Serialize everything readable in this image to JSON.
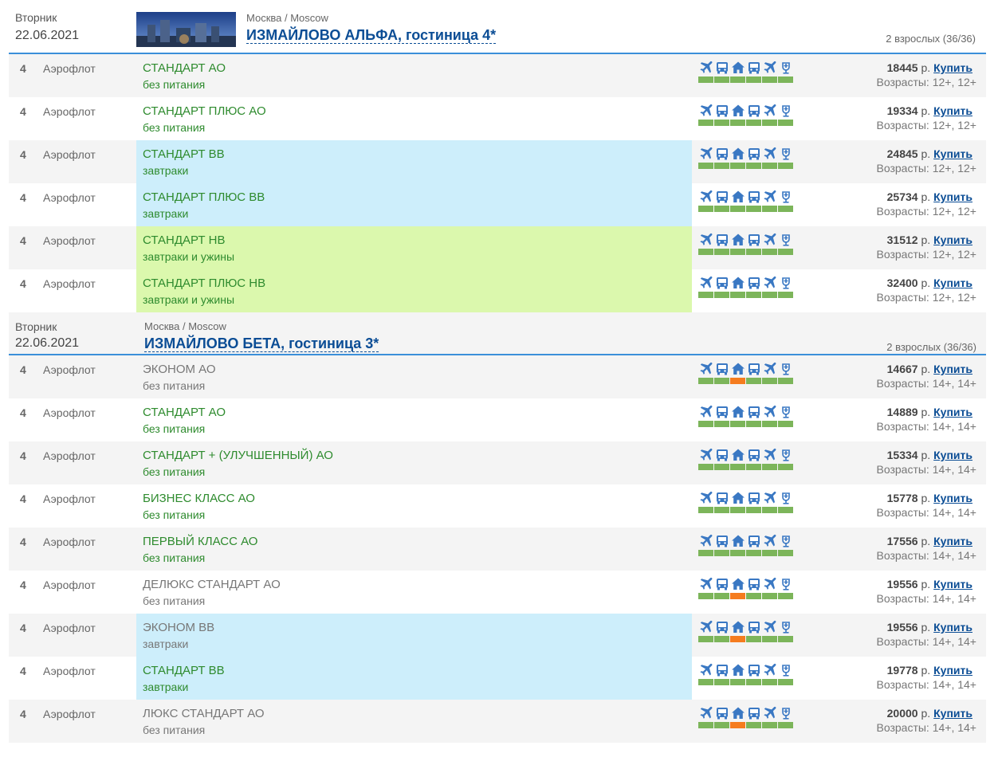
{
  "hotels": [
    {
      "day": "Вторник",
      "date": "22.06.2021",
      "city": "Москва / Moscow",
      "title": "ИЗМАЙЛОВО АЛЬФА, гостиница 4*",
      "adults": "2 взрослых (36/36)",
      "rows": [
        {
          "nights": "4",
          "airline": "Аэрофлот",
          "room": "СТАНДАРТ АО",
          "meal": "без питания",
          "price": "18445",
          "ages": "Возрасты: 12+, 12+",
          "room_color": "green",
          "meal_class": "none"
        },
        {
          "nights": "4",
          "airline": "Аэрофлот",
          "room": "СТАНДАРТ ПЛЮС АО",
          "meal": "без питания",
          "price": "19334",
          "ages": "Возрасты: 12+, 12+",
          "room_color": "green",
          "meal_class": "none"
        },
        {
          "nights": "4",
          "airline": "Аэрофлот",
          "room": "СТАНДАРТ ВВ",
          "meal": "завтраки",
          "price": "24845",
          "ages": "Возрасты: 12+, 12+",
          "room_color": "green",
          "meal_class": "bb"
        },
        {
          "nights": "4",
          "airline": "Аэрофлот",
          "room": "СТАНДАРТ ПЛЮС ВВ",
          "meal": "завтраки",
          "price": "25734",
          "ages": "Возрасты: 12+, 12+",
          "room_color": "green",
          "meal_class": "bb"
        },
        {
          "nights": "4",
          "airline": "Аэрофлот",
          "room": "СТАНДАРТ НВ",
          "meal": "завтраки и ужины",
          "price": "31512",
          "ages": "Возрасты: 12+, 12+",
          "room_color": "green",
          "meal_class": "hb"
        },
        {
          "nights": "4",
          "airline": "Аэрофлот",
          "room": "СТАНДАРТ ПЛЮС НВ",
          "meal": "завтраки и ужины",
          "price": "32400",
          "ages": "Возрасты: 12+, 12+",
          "room_color": "green",
          "meal_class": "hb"
        }
      ]
    },
    {
      "day": "Вторник",
      "date": "22.06.2021",
      "city": "Москва / Moscow",
      "title": "ИЗМАЙЛОВО БЕТА, гостиница 3*",
      "adults": "2 взрослых (36/36)",
      "rows": [
        {
          "nights": "4",
          "airline": "Аэрофлот",
          "room": "ЭКОНОМ АО",
          "meal": "без питания",
          "price": "14667",
          "ages": "Возрасты: 14+, 14+",
          "room_color": "gray",
          "meal_class": "none",
          "hotel_warn": true
        },
        {
          "nights": "4",
          "airline": "Аэрофлот",
          "room": "СТАНДАРТ АО",
          "meal": "без питания",
          "price": "14889",
          "ages": "Возрасты: 14+, 14+",
          "room_color": "green",
          "meal_class": "none"
        },
        {
          "nights": "4",
          "airline": "Аэрофлот",
          "room": "СТАНДАРТ + (УЛУЧШЕННЫЙ) АО",
          "meal": "без питания",
          "price": "15334",
          "ages": "Возрасты: 14+, 14+",
          "room_color": "green",
          "meal_class": "none"
        },
        {
          "nights": "4",
          "airline": "Аэрофлот",
          "room": "БИЗНЕС КЛАСС АО",
          "meal": "без питания",
          "price": "15778",
          "ages": "Возрасты: 14+, 14+",
          "room_color": "green",
          "meal_class": "none"
        },
        {
          "nights": "4",
          "airline": "Аэрофлот",
          "room": "ПЕРВЫЙ КЛАСС АО",
          "meal": "без питания",
          "price": "17556",
          "ages": "Возрасты: 14+, 14+",
          "room_color": "green",
          "meal_class": "none"
        },
        {
          "nights": "4",
          "airline": "Аэрофлот",
          "room": "ДЕЛЮКС СТАНДАРТ АО",
          "meal": "без питания",
          "price": "19556",
          "ages": "Возрасты: 14+, 14+",
          "room_color": "gray",
          "meal_class": "none",
          "hotel_warn": true
        },
        {
          "nights": "4",
          "airline": "Аэрофлот",
          "room": "ЭКОНОМ ВВ",
          "meal": "завтраки",
          "price": "19556",
          "ages": "Возрасты: 14+, 14+",
          "room_color": "gray",
          "meal_class": "bb",
          "hotel_warn": true
        },
        {
          "nights": "4",
          "airline": "Аэрофлот",
          "room": "СТАНДАРТ ВВ",
          "meal": "завтраки",
          "price": "19778",
          "ages": "Возрасты: 14+, 14+",
          "room_color": "green",
          "meal_class": "bb"
        },
        {
          "nights": "4",
          "airline": "Аэрофлот",
          "room": "ЛЮКС СТАНДАРТ АО",
          "meal": "без питания",
          "price": "20000",
          "ages": "Возрасты: 14+, 14+",
          "room_color": "gray",
          "meal_class": "none",
          "hotel_warn": true
        }
      ]
    }
  ],
  "labels": {
    "currency": "р.",
    "buy": "Купить"
  },
  "icons": [
    "plane-out-icon",
    "bus-icon",
    "hotel-icon",
    "bus-back-icon",
    "plane-back-icon",
    "insurance-icon"
  ],
  "colors": {
    "accent": "#0b4d95",
    "separator": "#3b8fd9",
    "status_ok": "#7cb55a",
    "status_warn": "#f57c1f",
    "breakfast_bg": "#cdeefb",
    "halfboard_bg": "#dbf8ad",
    "room_available": "#2e8b2e",
    "room_request": "#777777"
  }
}
